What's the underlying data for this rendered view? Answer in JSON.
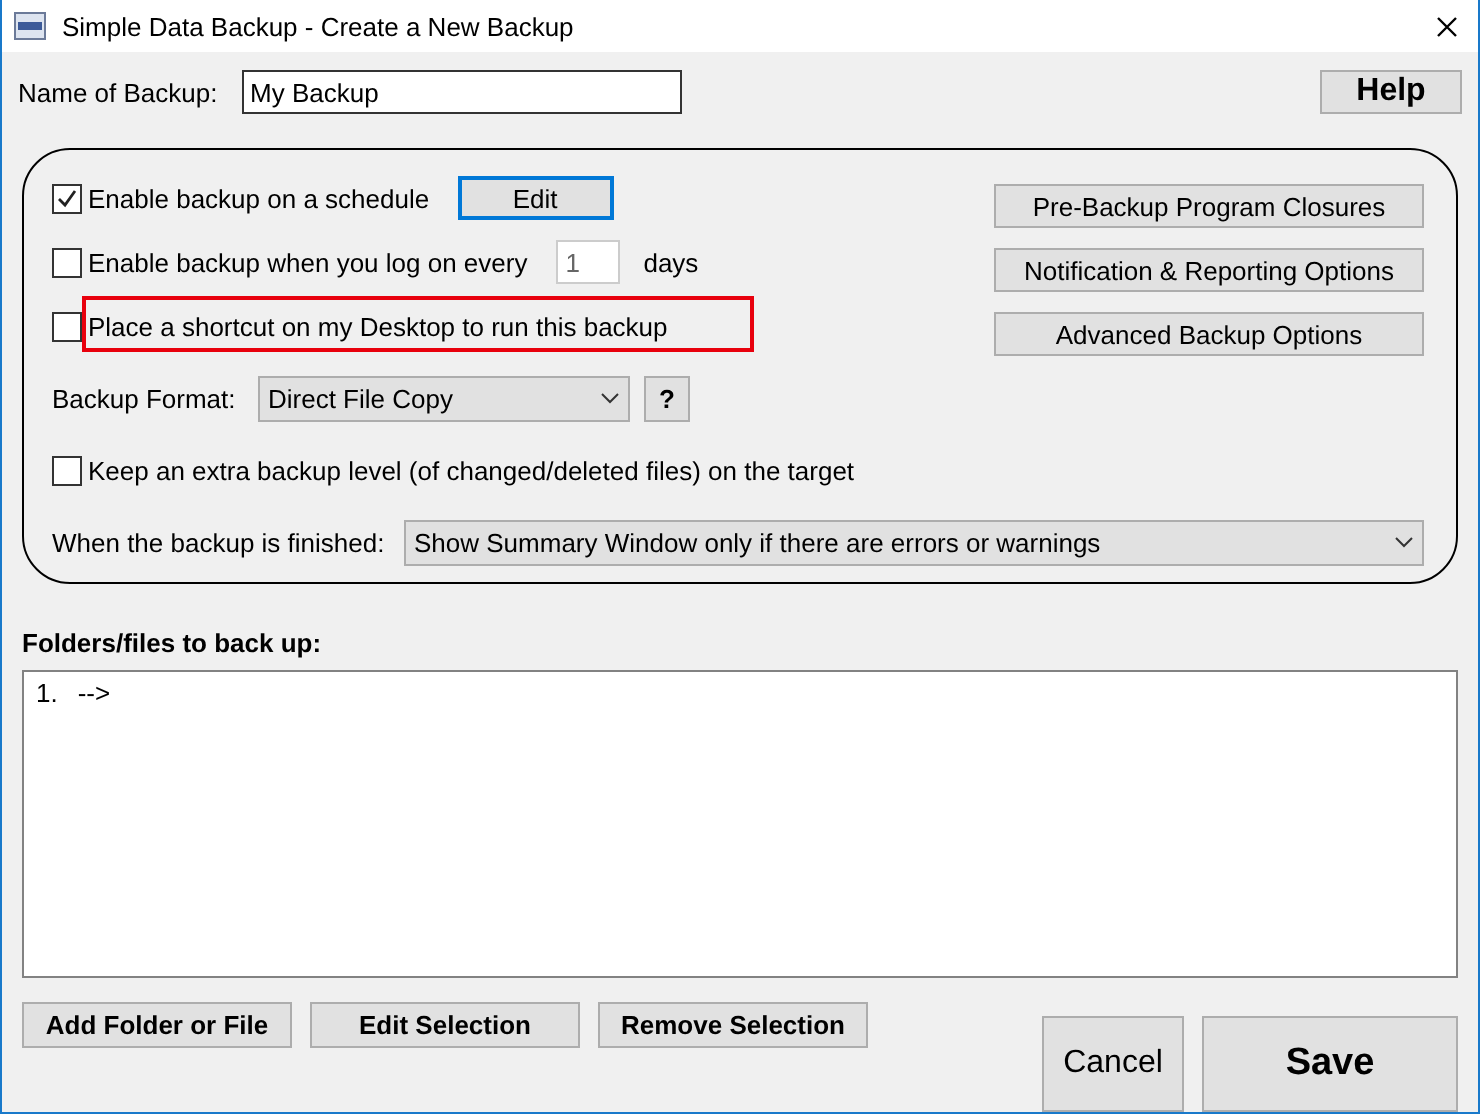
{
  "window": {
    "title": "Simple Data Backup - Create a New Backup"
  },
  "name_field": {
    "label": "Name of Backup:",
    "value": "My Backup"
  },
  "help_button": "Help",
  "options": [
    {
      "kind": "schedule",
      "label": "Enable backup on a schedule",
      "checked": true,
      "highlighted": false,
      "button": "Edit"
    },
    {
      "kind": "logon",
      "label": "Enable backup when you log on every",
      "checked": false,
      "highlighted": false,
      "value": "1",
      "unit": "days"
    },
    {
      "kind": "plain",
      "label": "Place a shortcut on my Desktop to run this backup",
      "checked": false,
      "highlighted": true
    }
  ],
  "backup_format": {
    "label": "Backup Format:",
    "value": "Direct File Copy",
    "help": "?"
  },
  "extra_level": {
    "label": "Keep an extra backup level (of changed/deleted files) on the target",
    "checked": false
  },
  "side_buttons": [
    "Pre-Backup Program Closures",
    "Notification & Reporting Options",
    "Advanced Backup Options"
  ],
  "when_finished": {
    "label": "When the backup is finished:",
    "value": "Show Summary Window only if there are errors or warnings"
  },
  "folders": {
    "label": "Folders/files to back up:",
    "items": [
      {
        "number": "1.",
        "text": "-->"
      }
    ]
  },
  "list_buttons": [
    "Add Folder or File",
    "Edit Selection",
    "Remove Selection"
  ],
  "cancel_button": "Cancel",
  "save_button": "Save"
}
